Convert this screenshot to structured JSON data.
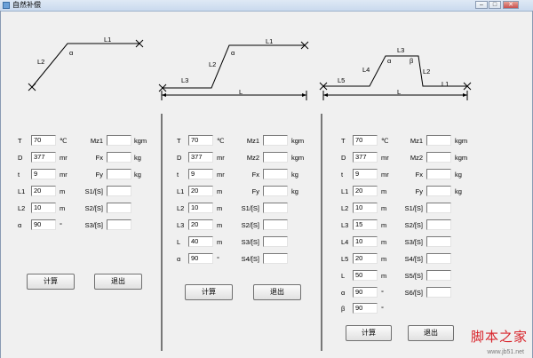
{
  "window": {
    "title": "自然补偿",
    "minimize": "–",
    "maximize": "□",
    "close": "✕"
  },
  "diagrams": {
    "d1": {
      "L1": "L1",
      "L2": "L2",
      "alpha": "α"
    },
    "d2": {
      "L1": "L1",
      "L2": "L2",
      "L3": "L3",
      "L": "L",
      "alpha": "α"
    },
    "d3": {
      "L1": "L1",
      "L2": "L2",
      "L3": "L3",
      "L4": "L4",
      "L5": "L5",
      "L": "L",
      "alpha": "α",
      "beta": "β"
    }
  },
  "panel1": {
    "rows": [
      {
        "label": "T",
        "value": "70",
        "unit": "℃"
      },
      {
        "label": "D",
        "value": "377",
        "unit": "mr"
      },
      {
        "label": "t",
        "value": "9",
        "unit": "mr"
      },
      {
        "label": "L1",
        "value": "20",
        "unit": "m"
      },
      {
        "label": "L2",
        "value": "10",
        "unit": "m"
      },
      {
        "label": "α",
        "value": "90",
        "unit": "°"
      }
    ],
    "outputs": [
      {
        "label": "Mz1",
        "value": "",
        "unit": "kgm"
      },
      {
        "label": "Fx",
        "value": "",
        "unit": "kg"
      },
      {
        "label": "Fy",
        "value": "",
        "unit": "kg"
      },
      {
        "label": "S1/[S]",
        "value": "",
        "unit": ""
      },
      {
        "label": "S2/[S]",
        "value": "",
        "unit": ""
      },
      {
        "label": "S3/[S]",
        "value": "",
        "unit": ""
      }
    ],
    "calc_button": "计算",
    "exit_button": "退出"
  },
  "panel2": {
    "rows": [
      {
        "label": "T",
        "value": "70",
        "unit": "℃"
      },
      {
        "label": "D",
        "value": "377",
        "unit": "mr"
      },
      {
        "label": "t",
        "value": "9",
        "unit": "mr"
      },
      {
        "label": "L1",
        "value": "20",
        "unit": "m"
      },
      {
        "label": "L2",
        "value": "10",
        "unit": "m"
      },
      {
        "label": "L3",
        "value": "20",
        "unit": "m"
      },
      {
        "label": "L",
        "value": "40",
        "unit": "m"
      },
      {
        "label": "α",
        "value": "90",
        "unit": "°"
      }
    ],
    "outputs": [
      {
        "label": "Mz1",
        "value": "",
        "unit": "kgm"
      },
      {
        "label": "Mz2",
        "value": "",
        "unit": "kgm"
      },
      {
        "label": "Fx",
        "value": "",
        "unit": "kg"
      },
      {
        "label": "Fy",
        "value": "",
        "unit": "kg"
      },
      {
        "label": "S1/[S]",
        "value": "",
        "unit": ""
      },
      {
        "label": "S2/[S]",
        "value": "",
        "unit": ""
      },
      {
        "label": "S3/[S]",
        "value": "",
        "unit": ""
      },
      {
        "label": "S4/[S]",
        "value": "",
        "unit": ""
      }
    ],
    "calc_button": "计算",
    "exit_button": "退出"
  },
  "panel3": {
    "rows": [
      {
        "label": "T",
        "value": "70",
        "unit": "℃"
      },
      {
        "label": "D",
        "value": "377",
        "unit": "mr"
      },
      {
        "label": "t",
        "value": "9",
        "unit": "mr"
      },
      {
        "label": "L1",
        "value": "20",
        "unit": "m"
      },
      {
        "label": "L2",
        "value": "10",
        "unit": "m"
      },
      {
        "label": "L3",
        "value": "15",
        "unit": "m"
      },
      {
        "label": "L4",
        "value": "10",
        "unit": "m"
      },
      {
        "label": "L5",
        "value": "20",
        "unit": "m"
      },
      {
        "label": "L",
        "value": "50",
        "unit": "m"
      },
      {
        "label": "α",
        "value": "90",
        "unit": "°"
      },
      {
        "label": "β",
        "value": "90",
        "unit": "°"
      }
    ],
    "outputs": [
      {
        "label": "Mz1",
        "value": "",
        "unit": "kgm"
      },
      {
        "label": "Mz2",
        "value": "",
        "unit": "kgm"
      },
      {
        "label": "Fx",
        "value": "",
        "unit": "kg"
      },
      {
        "label": "Fy",
        "value": "",
        "unit": "kg"
      },
      {
        "label": "S1/[S]",
        "value": "",
        "unit": ""
      },
      {
        "label": "S2/[S]",
        "value": "",
        "unit": ""
      },
      {
        "label": "S3/[S]",
        "value": "",
        "unit": ""
      },
      {
        "label": "S4/[S]",
        "value": "",
        "unit": ""
      },
      {
        "label": "S5/[S]",
        "value": "",
        "unit": ""
      },
      {
        "label": "S6/[S]",
        "value": "",
        "unit": ""
      }
    ],
    "calc_button": "计算",
    "exit_button": "退出"
  },
  "watermark": {
    "text": "脚本之家",
    "url": "www.jb51.net"
  }
}
